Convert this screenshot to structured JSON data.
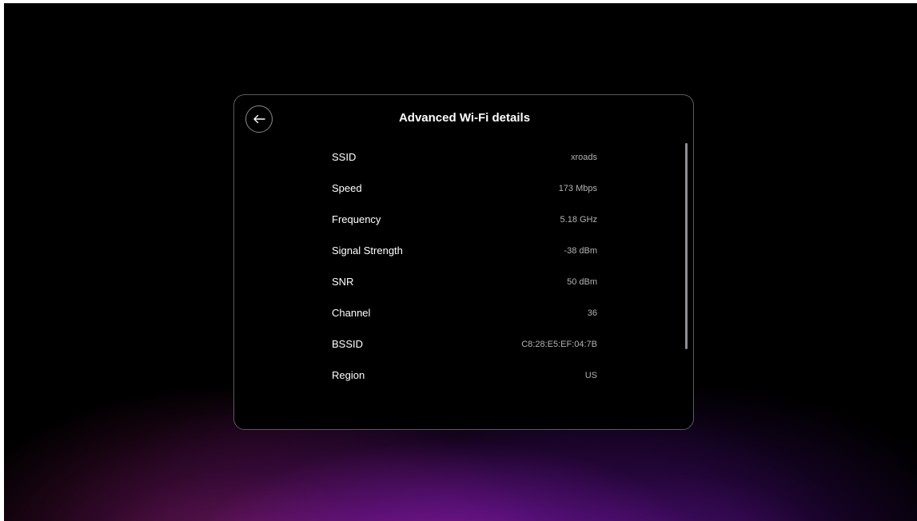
{
  "header": {
    "title": "Advanced Wi-Fi details",
    "back_icon": "arrow-left-icon"
  },
  "details": [
    {
      "label": "SSID",
      "value": "xroads"
    },
    {
      "label": "Speed",
      "value": "173 Mbps"
    },
    {
      "label": "Frequency",
      "value": "5.18 GHz"
    },
    {
      "label": "Signal Strength",
      "value": "-38 dBm"
    },
    {
      "label": "SNR",
      "value": "50 dBm"
    },
    {
      "label": "Channel",
      "value": "36"
    },
    {
      "label": "BSSID",
      "value": "C8:28:E5:EF:04:7B"
    },
    {
      "label": "Region",
      "value": "US"
    }
  ],
  "colors": {
    "background": "#000000",
    "accent_glow": "#8e1aa6",
    "text_primary": "#ffffff",
    "text_secondary": "#b3b3b6"
  }
}
